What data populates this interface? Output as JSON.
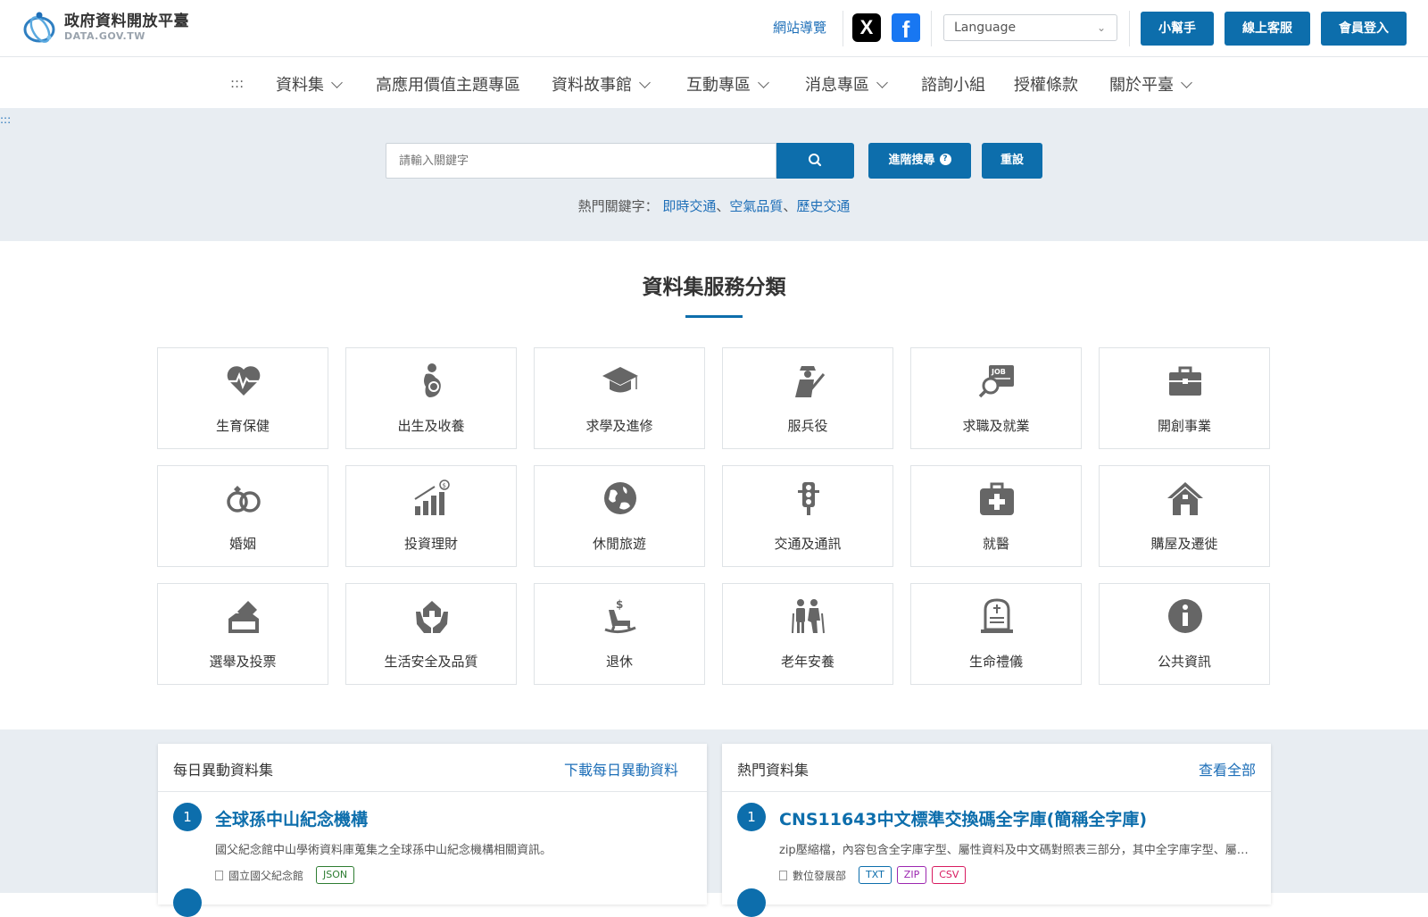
{
  "header": {
    "logo_title": "政府資料開放平臺",
    "logo_sub": "DATA.GOV.TW",
    "sitemap": "網站導覽",
    "social_x": "X",
    "social_fb": "f",
    "language": "Language",
    "helper": "小幫手",
    "support": "線上客服",
    "login": "會員登入"
  },
  "nav": {
    "accesskey": ":::",
    "items": [
      "資料集",
      "高應用價值主題專區",
      "資料故事館",
      "互動專區",
      "消息專區",
      "諮詢小組",
      "授權條款",
      "關於平臺"
    ]
  },
  "search": {
    "skip": ":::",
    "placeholder": "請輸入關鍵字",
    "advanced": "進階搜尋",
    "advanced_help": "?",
    "reset": "重設",
    "hot_label": "熱門關鍵字：",
    "hot_keywords": [
      "即時交通",
      "空氣品質",
      "歷史交通"
    ],
    "separator": "、"
  },
  "categories": {
    "title": "資料集服務分類",
    "items": [
      {
        "label": "生育保健",
        "icon": "heart-pulse-icon"
      },
      {
        "label": "出生及收養",
        "icon": "mother-baby-icon"
      },
      {
        "label": "求學及進修",
        "icon": "graduation-cap-icon"
      },
      {
        "label": "服兵役",
        "icon": "soldier-icon"
      },
      {
        "label": "求職及就業",
        "icon": "job-search-icon"
      },
      {
        "label": "開創事業",
        "icon": "briefcase-icon"
      },
      {
        "label": "婚姻",
        "icon": "rings-icon"
      },
      {
        "label": "投資理財",
        "icon": "growth-chart-icon"
      },
      {
        "label": "休閒旅遊",
        "icon": "globe-icon"
      },
      {
        "label": "交通及通訊",
        "icon": "traffic-light-icon"
      },
      {
        "label": "就醫",
        "icon": "medical-kit-icon"
      },
      {
        "label": "購屋及遷徙",
        "icon": "house-icon"
      },
      {
        "label": "選舉及投票",
        "icon": "ballot-box-icon"
      },
      {
        "label": "生活安全及品質",
        "icon": "hands-house-icon"
      },
      {
        "label": "退休",
        "icon": "rocking-chair-icon"
      },
      {
        "label": "老年安養",
        "icon": "elderly-icon"
      },
      {
        "label": "生命禮儀",
        "icon": "tombstone-icon"
      },
      {
        "label": "公共資訊",
        "icon": "info-icon"
      }
    ]
  },
  "daily": {
    "title": "每日異動資料集",
    "link": "下載每日異動資料",
    "item": {
      "rank": "1",
      "title": "全球孫中山紀念機構",
      "desc": "國父紀念館中山學術資料庫蒐集之全球孫中山紀念機構相關資訊。",
      "org": "國立國父紀念館",
      "tags": [
        "JSON"
      ]
    }
  },
  "popular": {
    "title": "熱門資料集",
    "link": "查看全部",
    "item": {
      "rank": "1",
      "title": "CNS11643中文標準交換碼全字庫(簡稱全字庫)",
      "desc": "zip壓縮檔，內容包含全字庫字型、屬性資料及中文碼對照表三部分，其中全字庫字型、屬性資料及中文碼對照表三部分",
      "org": "數位發展部",
      "tags": [
        "TXT",
        "ZIP",
        "CSV"
      ]
    }
  },
  "colors": {
    "primary": "#0d6eac",
    "link": "#1e6fb8",
    "band": "#e8edf2",
    "icon": "#666666"
  }
}
